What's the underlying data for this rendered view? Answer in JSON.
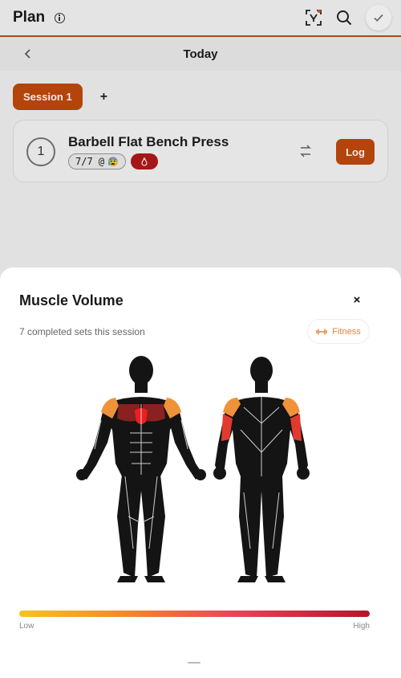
{
  "header": {
    "title": "Plan"
  },
  "datebar": {
    "label": "Today"
  },
  "tabs": {
    "session_label": "Session 1",
    "add_label": "+"
  },
  "exercise": {
    "number": "1",
    "name": "Barbell Flat Bench Press",
    "sets_chip": "7/7 @",
    "sets_emoji": "😰",
    "log_label": "Log"
  },
  "sheet": {
    "title": "Muscle Volume",
    "close_label": "×",
    "subtitle": "7 completed sets this session",
    "fitness_label": "Fitness",
    "legend_low": "Low",
    "legend_high": "High"
  },
  "colors": {
    "accent": "#c44a0d",
    "chest_high": "#e02020",
    "shoulder": "#f0923a",
    "tricep": "#e33a2f"
  }
}
